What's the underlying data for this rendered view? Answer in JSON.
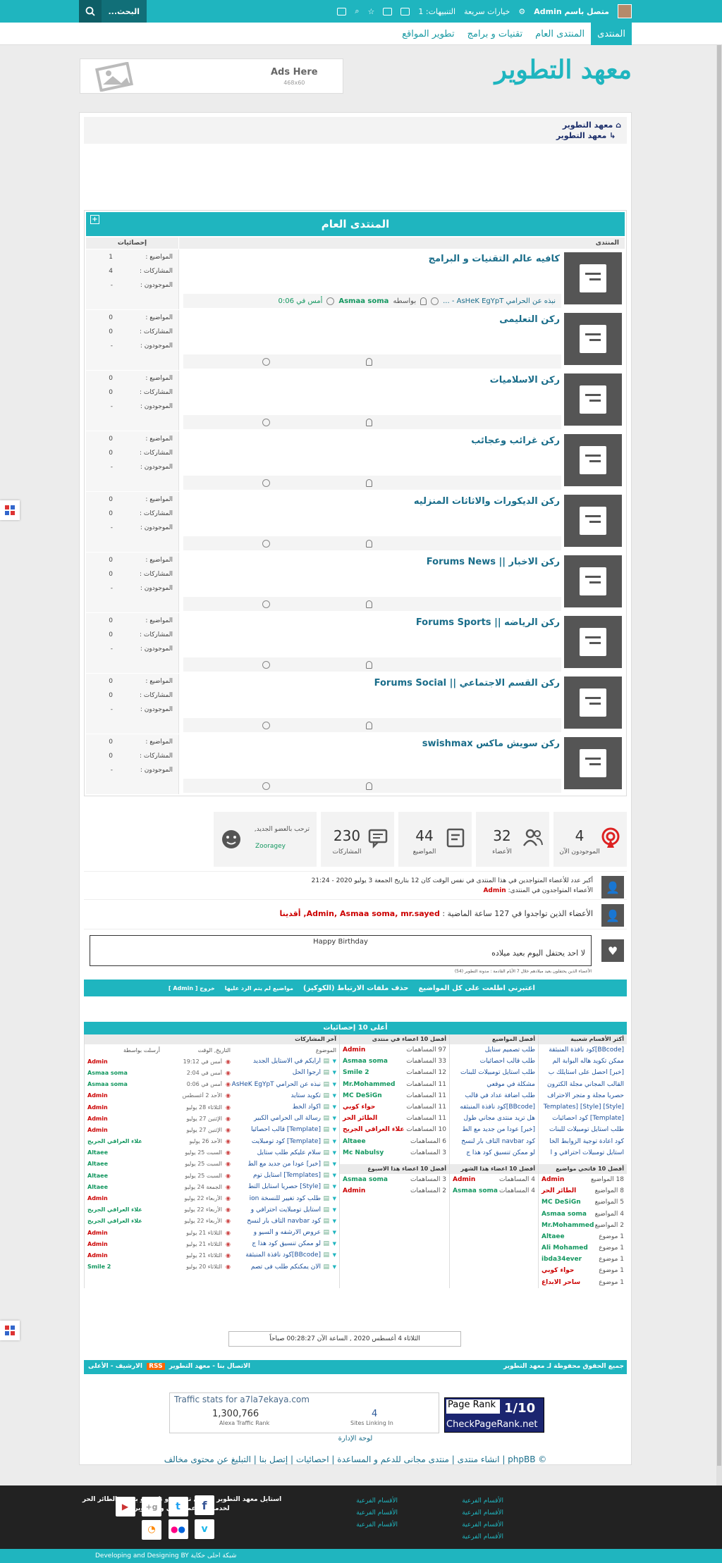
{
  "topbar": {
    "user": "متصل باسم Admin",
    "quick": "خيارات سريعة",
    "notif": "التنبيهات: 1",
    "search": "البحث..."
  },
  "nav": [
    "المنتدى",
    "المنتدى العام",
    "تقنيات و برامج",
    "تطوير المواقع"
  ],
  "logo": "معهد التطوير",
  "ads": {
    "title": "Ads Here",
    "size": "468x60"
  },
  "breadcrumb": [
    "معهد التطوير",
    "معهد التطوير"
  ],
  "forum": {
    "title": "المنتدى العام",
    "col_forum": "المنتدى",
    "col_stats": "إحصائيات",
    "labels": {
      "topics": "المواضيع",
      "posts": "المشاركات",
      "online": "الموجودون"
    },
    "rows": [
      {
        "name": "كافيه عالم التقنيات و البرامج",
        "topics": "1",
        "posts": "4",
        "online": "-",
        "last_title": "نبذه عن الحرامي AsHeK EgYpT - ...",
        "last_by": "بواسطه",
        "last_user": "Asmaa soma",
        "last_time": "أمس في 0:06"
      },
      {
        "name": "ركن التعليمى",
        "topics": "0",
        "posts": "0",
        "online": "-"
      },
      {
        "name": "ركن الاسلاميات",
        "topics": "0",
        "posts": "0",
        "online": "-"
      },
      {
        "name": "ركن غرائب وعجائب",
        "topics": "0",
        "posts": "0",
        "online": "-"
      },
      {
        "name": "ركن الديكورات والاثاثات المنزليه",
        "topics": "0",
        "posts": "0",
        "online": "-"
      },
      {
        "name": "ركن الاخبار || Forums News",
        "topics": "0",
        "posts": "0",
        "online": "-"
      },
      {
        "name": "ركن الرياضه || Forums Sports",
        "topics": "0",
        "posts": "0",
        "online": "-"
      },
      {
        "name": "ركن القسم الاجتماعي || Forums Social",
        "topics": "0",
        "posts": "0",
        "online": "-"
      },
      {
        "name": "ركن سويش ماكس swishmax",
        "topics": "0",
        "posts": "0",
        "online": "-"
      }
    ]
  },
  "stats": [
    {
      "num": "4",
      "label": "الموجودون الآن"
    },
    {
      "num": "32",
      "label": "الأعضاء"
    },
    {
      "num": "44",
      "label": "المواضيع"
    },
    {
      "num": "230",
      "label": "المشاركات"
    },
    {
      "num": "",
      "label": "ترحب بالعضو الجديد,",
      "user": "Zooragey"
    }
  ],
  "online_info": {
    "line1": "أكبر عدد للأعضاء المتواجدين في هذا المنتدى في نفس الوقت كان 12 بتاريخ الجمعة 3 يوليو 2020 - 21:24",
    "line2": "الأعضاء المتواجدون في المنتدى:",
    "line2_user": "Admin",
    "last24": "الأعضاء الذين تواجدوا في 127 ساعة الماضية :",
    "last24_users": "Admin, Asmaa soma, mr.sayed, أقدينا"
  },
  "birthday": {
    "title": "Happy Birthday",
    "text": "لا احد يحتفل اليوم بعيد ميلاده",
    "legend": "الأعضاء الذين يحتفلون بعيد ميلادهم خلال 7 الأيام القادمة : مدونة التطوير (54)"
  },
  "links": [
    "اعتبرني اطلعت على كل المواضيع",
    "حذف ملفات الارتباط (الكوكيز)",
    "مواضيع لم يتم الرد عليها",
    "خروج [ Admin ]"
  ],
  "top10": {
    "title": "أعلى 10 إحصائيات",
    "col_popular": "أكثر الأقسام شعبية",
    "col_topics": "أفضل المواضيع",
    "col_posters": "أفضل 10 اعضاء في منتدى",
    "col_recent": "آخر المشاركات",
    "col_recent_heads": [
      "الموضوع",
      "التاريخ, الوقت",
      "أرسلت بواسطة"
    ],
    "popular": [
      "[BBcode]كود نافذة المنبثقة",
      "ممكن تكويد هاله البوابة الم",
      "[خبر] احصل على استايلك ب",
      "القالب المجاني مجلة الكترون",
      "حصريا مجلة و متجر الاحتراف",
      "[Style] [Style] [Templates",
      "[Template] كود احصائيات",
      "طلب استايل تومبيلات للبنات",
      "كود اعادة توجية الزوابط الخا",
      "استايل تومبيلات احترافي و ا"
    ],
    "topics": [
      "طلب تصميم ستايل",
      "طلب قالب احصائيات",
      "طلب استايل تومبيلات للبنات",
      "مشكلة في موقعي",
      "طلب اضافة عداد في قالب",
      "[BBcode]كود نافذة المنبثقه",
      "هل تريد منتدى مجاني طول",
      "[خبر] عودا من جديد مع الط",
      "كود navbar التاف بار لنسخ",
      "لو ممكن تنسيق كود هذا ج"
    ],
    "posters": [
      [
        "Admin",
        "97 المساهمات"
      ],
      [
        "Asmaa soma",
        "33 المساهمات"
      ],
      [
        "Smile 2",
        "12 المساهمات"
      ],
      [
        "Mr.Mohammed",
        "11 المساهمات"
      ],
      [
        "MC DeSiGn",
        "11 المساهمات"
      ],
      [
        "حواء كوبي",
        "11 المساهمات"
      ],
      [
        "الطائر الحر",
        "11 المساهمات"
      ],
      [
        "علاء العراقي الجريح",
        "10 المساهمات"
      ],
      [
        "Altaee",
        "6 المساهمات"
      ],
      [
        "Mc Nabulsy",
        "3 المساهمات"
      ]
    ],
    "recent": [
      [
        "ارايكم في الاستايل الجديد",
        "أمس في 19:12",
        "Admin"
      ],
      [
        "ارجوا الحل",
        "أمس في 2:04",
        "Asmaa soma"
      ],
      [
        "نبذه عن الحرامي AsHeK EgYpT",
        "أمس في 0:06",
        "Asmaa soma"
      ],
      [
        "تكويد ستايد",
        "الأحد 2 أغسطس",
        "Admin"
      ],
      [
        "اكواد الخط",
        "الثلاثاء 28 يوليو",
        "Admin"
      ],
      [
        "رسالة الى الحرامي الكبير",
        "الإثنين 27 يوليو",
        "Admin"
      ],
      [
        "[Template] قالب احصائيا",
        "الإثنين 27 يوليو",
        "Admin"
      ],
      [
        "[Template] كود تومبلايت",
        "الأحد 26 يوليو",
        "علاء العراقي الجريح"
      ],
      [
        "سلام عليكم طلب ستايل",
        "السبت 25 يوليو",
        "Altaee"
      ],
      [
        "[خبر] عودا من جديد مع الط",
        "السبت 25 يوليو",
        "Altaee"
      ],
      [
        "[Templates] استايل توم",
        "السبت 25 يوليو",
        "Altaee"
      ],
      [
        "[Style] حصريا استايل التط",
        "الجمعة 24 يوليو",
        "Altaee"
      ],
      [
        "طلب كود تغيير للنسخة ion",
        "الأربعاء 22 يوليو",
        "Admin"
      ],
      [
        "استايل تومبلايت احترافي و",
        "الأربعاء 22 يوليو",
        "علاء العراقي الجريح"
      ],
      [
        "كود navbar التاف بار لنسخ",
        "الأربعاء 22 يوليو",
        "علاء العراقي الجريح"
      ],
      [
        "عروض الارشفه و السيو و",
        "الثلاثاء 21 يوليو",
        "Admin"
      ],
      [
        "لو ممكن تنسيق كود هذا ج",
        "الثلاثاء 21 يوليو",
        "Admin"
      ],
      [
        "[BBcode]كود نافذة المنبثقة",
        "الثلاثاء 21 يوليو",
        "Admin"
      ],
      [
        "الان يمكنكم طلب فى تصم",
        "الثلاثاء 20 يوليو",
        "Smile 2"
      ]
    ],
    "col_week": "أفضل 10 اعضاء هذا الاسبوع",
    "col_month": "أفضل 10 اعضاء هذا الشهر",
    "col_starters": "أفضل 10 فاتحي مواضيع",
    "week": [
      [
        "Asmaa soma",
        "3 المساهمات"
      ],
      [
        "Admin",
        "2 المساهمات"
      ]
    ],
    "month": [
      [
        "Admin",
        "4 المساهمات"
      ],
      [
        "Asmaa soma",
        "4 المساهمات"
      ]
    ],
    "starters": [
      [
        "Admin",
        "18 المواضيع"
      ],
      [
        "الطائر الحر",
        "8 المواضيع"
      ],
      [
        "MC DeSiGn",
        "5 المواضيع"
      ],
      [
        "Asmaa soma",
        "4 المواضيع"
      ],
      [
        "Mr.Mohammed",
        "2 المواضيع"
      ],
      [
        "Altaee",
        "1 موضوع"
      ],
      [
        "Ali Mohamed",
        "1 موضوع"
      ],
      [
        "ibda34ever",
        "1 موضوع"
      ],
      [
        "حواء كوبي",
        "1 موضوع"
      ],
      [
        "ساحر الابداع",
        "1 موضوع"
      ]
    ]
  },
  "date_line": "الثلاثاء 4 أغسطس 2020 , الساعة الآن 00:28:27 صباحاً",
  "bar2": {
    "right": "جميع الحقوق محفوظة لـ معهد التطوير",
    "left": "الاتصال بنا - معهد التطوير",
    "rss": "RSS",
    "arch": "الارشيف - الأعلى"
  },
  "alexa": {
    "title": "Traffic stats for a7la7ekaya.com",
    "rank": "1,300,766",
    "rank_label": "Alexa Traffic Rank",
    "links": "4",
    "links_label": "Sites Linking In"
  },
  "pagerank": {
    "label": "Page Rank",
    "value": "1/10",
    "site": "CheckPageRank.net"
  },
  "admin_link": "لوحة الإدارة",
  "copyright": "© phpBB | انشاء منتدى | منتدى مجانى للدعم و المساعدة | احصائيات | إتصل بنا | التبليغ عن محتوى مخالف",
  "footer": {
    "about": "استايل معهد التطوير العربي تصميم و تكويد و برمجة الطائر الحر لخدمات الدعم الفني و التطوير",
    "cat": "الأقسام الفرعية",
    "credit": "Developing and Designing BY شبكة احلى حكاية"
  },
  "colors": {
    "accent": "#1fb5bf"
  }
}
